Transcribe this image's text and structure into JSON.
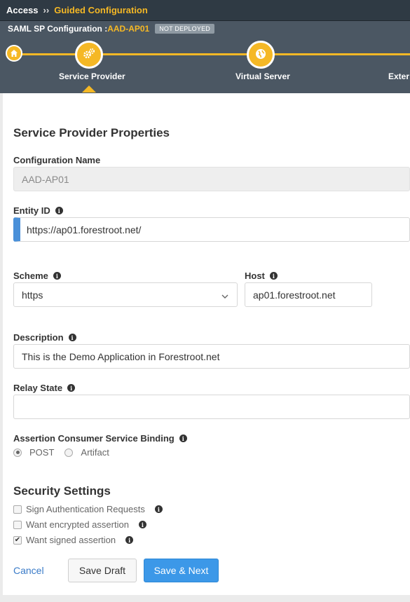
{
  "breadcrumb": {
    "root": "Access",
    "separator": "››",
    "current": "Guided Configuration"
  },
  "header": {
    "title_prefix": "SAML SP Configuration :",
    "config_name": "AAD-AP01",
    "status_badge": "NOT DEPLOYED"
  },
  "steps": [
    {
      "label": "Service Provider",
      "icon": "gears-icon"
    },
    {
      "label": "Virtual Server",
      "icon": "globe-icon"
    },
    {
      "label": "Exter"
    }
  ],
  "form": {
    "section_title": "Service Provider Properties",
    "config_name": {
      "label": "Configuration Name",
      "value": "AAD-AP01"
    },
    "entity_id": {
      "label": "Entity ID",
      "value": "https://ap01.forestroot.net/"
    },
    "scheme": {
      "label": "Scheme",
      "value": "https"
    },
    "host": {
      "label": "Host",
      "value": "ap01.forestroot.net"
    },
    "description": {
      "label": "Description",
      "value": "This is the Demo Application in Forestroot.net"
    },
    "relay_state": {
      "label": "Relay State",
      "value": ""
    },
    "binding": {
      "label": "Assertion Consumer Service Binding",
      "options": [
        "POST",
        "Artifact"
      ],
      "selected": "POST"
    }
  },
  "security": {
    "title": "Security Settings",
    "options": [
      {
        "label": "Sign Authentication Requests",
        "checked": false
      },
      {
        "label": "Want encrypted assertion",
        "checked": false
      },
      {
        "label": "Want signed assertion",
        "checked": true
      }
    ]
  },
  "actions": {
    "cancel": "Cancel",
    "save_draft": "Save Draft",
    "save_next": "Save & Next"
  },
  "colors": {
    "accent": "#f5b825",
    "primary": "#3c98e8",
    "header_bg": "#4b5763",
    "topbar_bg": "#2f3a44"
  }
}
